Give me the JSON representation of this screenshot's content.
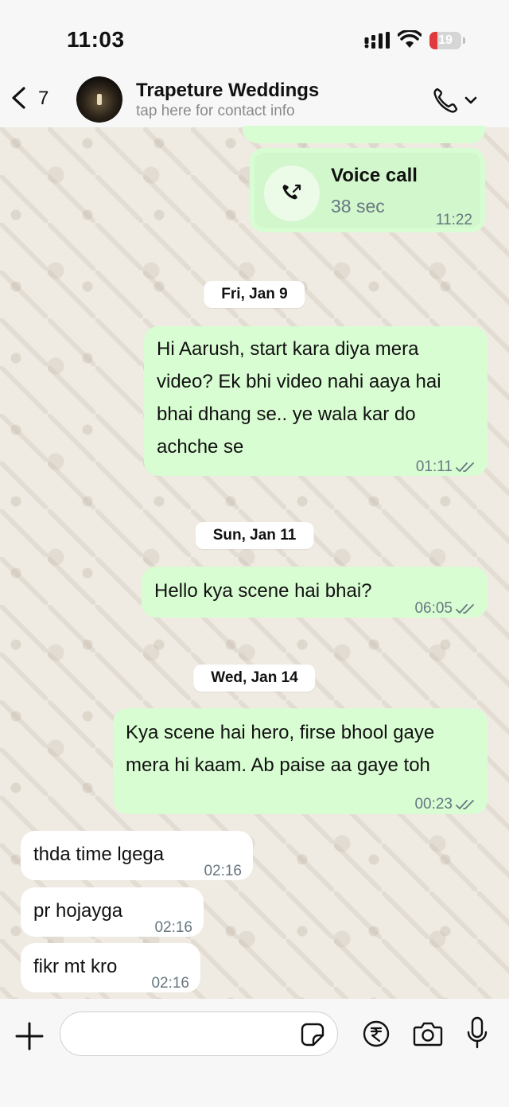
{
  "status_bar": {
    "time": "11:03",
    "battery_level": "19",
    "battery_color": "#e03a3e"
  },
  "header": {
    "unread_count": "7",
    "contact_name": "Trapeture Weddings",
    "contact_subtitle": "tap here for contact info"
  },
  "voice_call": {
    "title": "Voice call",
    "duration": "38 sec",
    "time": "11:22"
  },
  "dates": {
    "d1": "Fri, Jan 9",
    "d2": "Sun, Jan 11",
    "d3": "Wed, Jan 14"
  },
  "messages": [
    {
      "direction": "out",
      "lines": [
        "Hi Aarush, start kara diya mera",
        "video? Ek bhi video nahi aaya hai",
        "bhai dhang se.. ye wala kar do",
        "achche se"
      ],
      "time": "01:11",
      "read": true
    },
    {
      "direction": "out",
      "lines": [
        "Hello kya scene hai bhai?"
      ],
      "time": "06:05",
      "read": true
    },
    {
      "direction": "out",
      "lines": [
        "Kya scene hai hero, firse bhool gaye",
        "mera hi kaam. Ab paise aa gaye toh"
      ],
      "time": "00:23",
      "read": true
    },
    {
      "direction": "in",
      "lines": [
        "thda time lgega"
      ],
      "time": "02:16"
    },
    {
      "direction": "in",
      "lines": [
        "pr hojayga"
      ],
      "time": "02:16"
    },
    {
      "direction": "in",
      "lines": [
        "fikr mt kro"
      ],
      "time": "02:16"
    }
  ],
  "colors": {
    "outgoing_bubble": "#d9fdd3",
    "incoming_bubble": "#ffffff",
    "tick": "#667781"
  },
  "icons": [
    "back-chevron-icon",
    "phone-icon",
    "chevron-down-icon",
    "voice-call-outgoing-icon",
    "plus-icon",
    "sticker-icon",
    "rupee-icon",
    "camera-icon",
    "mic-icon"
  ]
}
